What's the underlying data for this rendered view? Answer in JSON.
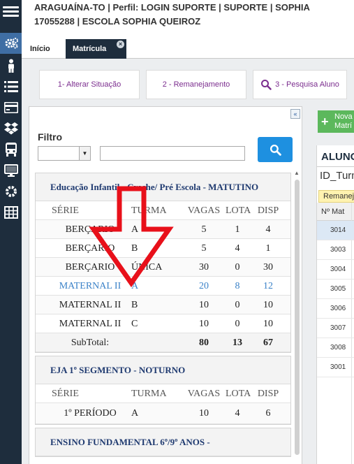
{
  "header": {
    "line1": "ARAGUAÍNA-TO  |  Perfil: LOGIN SUPORTE  |  SUPORTE  |  SOPHIA",
    "line2": "17055288  |  ESCOLA SOPHIA QUEIROZ"
  },
  "sidebar": {
    "icons": [
      "menu-icon",
      "gears-icon",
      "person-icon",
      "list-icon",
      "credit-card-icon",
      "dropbox-icon",
      "bus-icon",
      "monitor-icon",
      "gear-icon",
      "table-icon"
    ]
  },
  "tabs": {
    "home": "Início",
    "active": "Matrícula",
    "close": "×"
  },
  "actions": {
    "alterar": "1- Alterar Situação",
    "remanejamento": "2 - Remanejamento",
    "pesquisa": "3 - Pesquisa Aluno"
  },
  "filter": {
    "label": "Filtro",
    "select_value": "",
    "input_value": ""
  },
  "columns": {
    "serie": "SÉRIE",
    "turma": "TURMA",
    "vagas": "VAGAS",
    "lota": "LOTA",
    "disp": "DISP"
  },
  "groups": [
    {
      "title": "Educação Infantil - Creche/ Pré Escola - MATUTINO",
      "rows": [
        {
          "serie": "BERÇARIO",
          "turma": "A",
          "vagas": "5",
          "lota": "1",
          "disp": "4"
        },
        {
          "serie": "BERÇARIO",
          "turma": "B",
          "vagas": "5",
          "lota": "4",
          "disp": "1"
        },
        {
          "serie": "BERÇARIO",
          "turma": "ÚNICA",
          "vagas": "30",
          "lota": "0",
          "disp": "30"
        },
        {
          "serie": "MATERNAL II",
          "turma": "A",
          "vagas": "20",
          "lota": "8",
          "disp": "12"
        },
        {
          "serie": "MATERNAL II",
          "turma": "B",
          "vagas": "10",
          "lota": "0",
          "disp": "10"
        },
        {
          "serie": "MATERNAL II",
          "turma": "C",
          "vagas": "10",
          "lota": "0",
          "disp": "10"
        }
      ],
      "subtotal": {
        "label": "SubTotal:",
        "vagas": "80",
        "lota": "13",
        "disp": "67"
      }
    },
    {
      "title": "EJA 1º SEGMENTO - NOTURNO",
      "rows": [
        {
          "serie": "1º PERÍODO",
          "turma": "A",
          "vagas": "10",
          "lota": "4",
          "disp": "6"
        }
      ]
    },
    {
      "title": "ENSINO FUNDAMENTAL 6º/9º ANOS -"
    }
  ],
  "right_panel": {
    "nova_label": "Nova Matrí",
    "title": "ALUNOS",
    "subtitle": "ID_Turma",
    "remanejar": "Remanejar",
    "col_mat": "Nº Mat",
    "matriculas": [
      "3014",
      "3003",
      "3004",
      "3005",
      "3006",
      "3007",
      "3008",
      "3001"
    ]
  },
  "colors": {
    "sidebar": "#1e2d3d",
    "accent_blue": "#1e90e0",
    "action_text": "#7b2d8e",
    "group_title": "#1f3a70",
    "selected_row_text": "#3b82c8",
    "arrow": "#e8101a",
    "success": "#5cb85c"
  }
}
